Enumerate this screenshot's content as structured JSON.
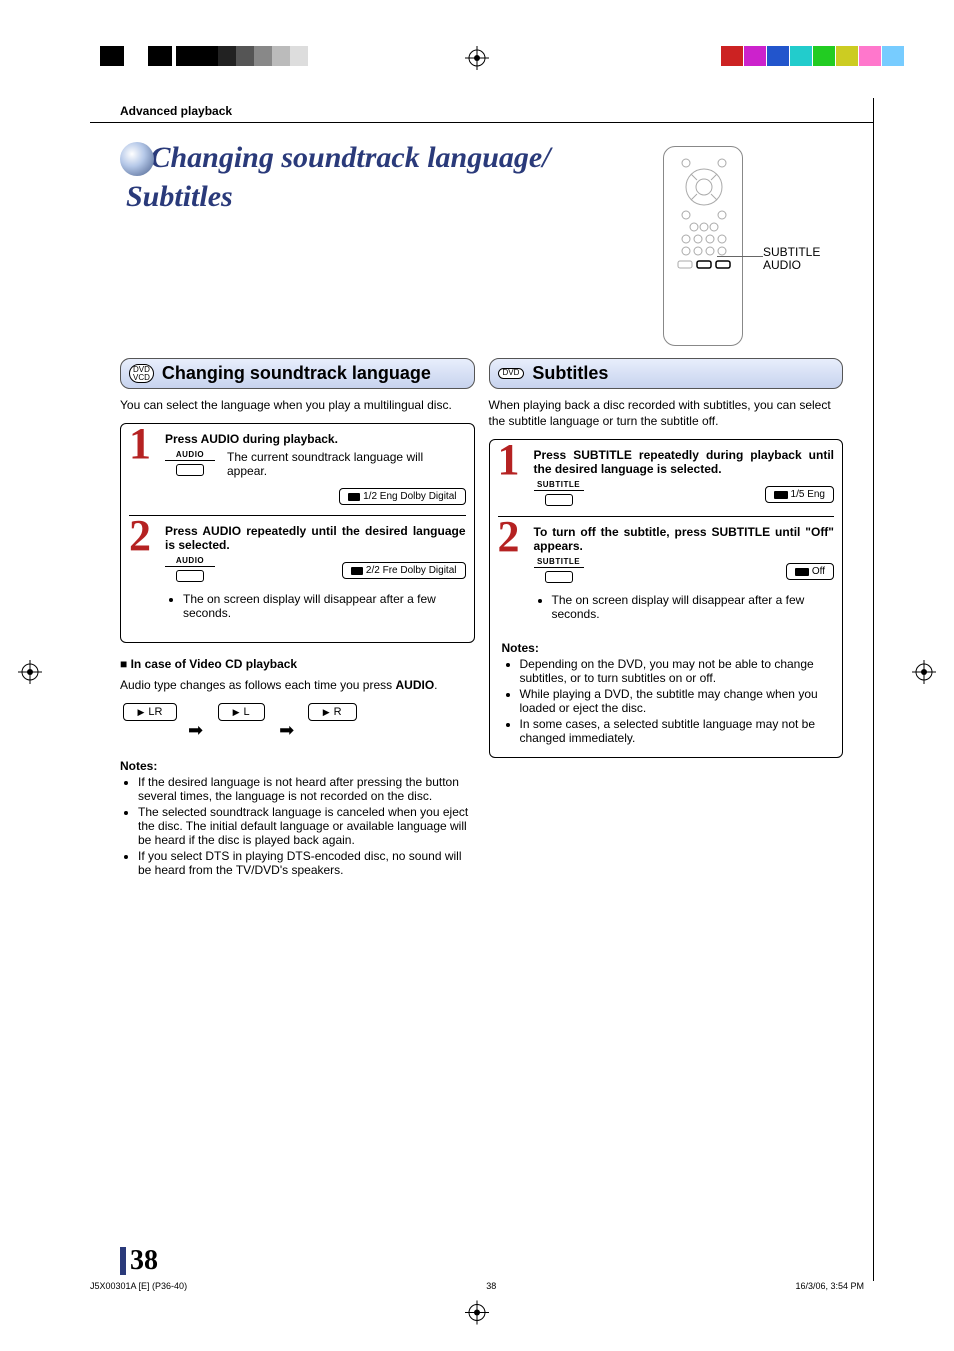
{
  "page": {
    "section_header": "Advanced playback",
    "title_line1": "Changing soundtrack language/",
    "title_line2": "Subtitles",
    "page_number": "38"
  },
  "remote": {
    "label_subtitle": "SUBTITLE",
    "label_audio": "AUDIO"
  },
  "left": {
    "badge": "DVD\nVCD",
    "heading": "Changing soundtrack language",
    "intro": "You can select the language when you play a multilingual disc.",
    "step1": {
      "num": "1",
      "title": "Press AUDIO during playback.",
      "btn_label": "AUDIO",
      "desc": "The current soundtrack language will appear.",
      "osd": "1/2 Eng Dolby Digital"
    },
    "step2": {
      "num": "2",
      "title": "Press AUDIO repeatedly until the desired language is selected.",
      "btn_label": "AUDIO",
      "osd": "2/2 Fre Dolby Digital"
    },
    "step_note": "The on screen display will disappear after a few seconds.",
    "vcd_head": "In case of Video CD playback",
    "vcd_desc_a": "Audio type changes as follows each time you press ",
    "vcd_desc_b": "AUDIO",
    "vcd_desc_c": ".",
    "seq": {
      "lr": "LR",
      "l": "L",
      "r": "R"
    },
    "notes_head": "Notes:",
    "notes": [
      "If the desired language is not heard after pressing the button several times, the language is not recorded on the disc.",
      "The selected soundtrack language is canceled when you eject the disc. The initial default language or available language will be heard if the disc is played back again.",
      "If you select DTS in playing DTS-encoded disc, no sound will be heard from the TV/DVD's speakers."
    ]
  },
  "right": {
    "badge": "DVD",
    "heading": "Subtitles",
    "intro": "When playing back a disc recorded with subtitles, you can select the subtitle language or turn the subtitle off.",
    "step1": {
      "num": "1",
      "title": "Press SUBTITLE repeatedly during playback until the desired language is selected.",
      "btn_label": "SUBTITLE",
      "osd": "1/5 Eng"
    },
    "step2": {
      "num": "2",
      "title": "To turn off the subtitle, press SUBTITLE until \"Off\" appears.",
      "btn_label": "SUBTITLE",
      "osd": "Off"
    },
    "step_note": "The on screen display will disappear after a few seconds.",
    "notes_head": "Notes:",
    "notes": [
      "Depending on the DVD, you may not be able to change subtitles, or to turn subtitles on or off.",
      "While playing a DVD, the subtitle may change when you loaded or eject the disc.",
      "In some cases, a selected subtitle language may not be changed immediately."
    ]
  },
  "footer": {
    "file": "J5X00301A [E] (P36-40)",
    "page": "38",
    "timestamp": "16/3/06, 3:54 PM"
  }
}
